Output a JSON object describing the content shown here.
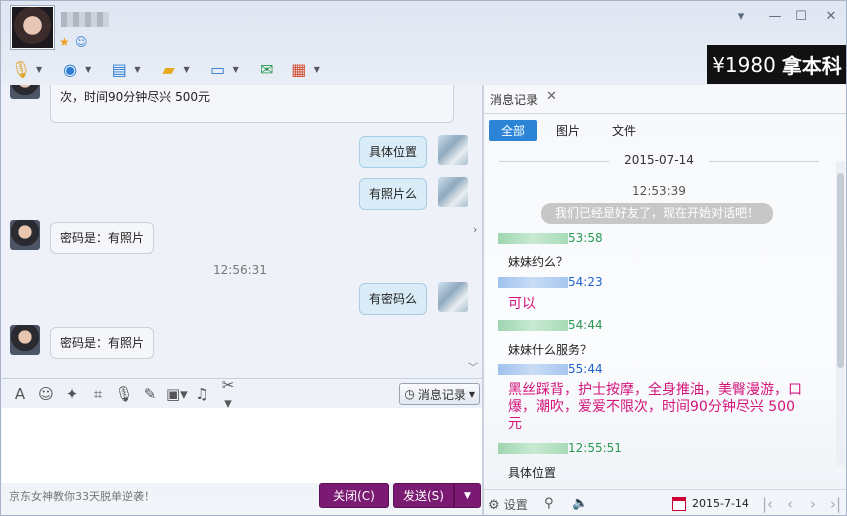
{
  "header": {
    "status_icons": [
      "star-icon",
      "qq-icon"
    ]
  },
  "ad": {
    "price": "¥1980",
    "text": "拿本科"
  },
  "chat": {
    "msg0_tail": "次，时间90分钟尽兴 500元",
    "msg1": "具体位置",
    "msg2": "有照片么",
    "msg3": "密码是：有照片",
    "ts1": "12:56:31",
    "msg4": "有密码么",
    "msg5": "密码是：有照片"
  },
  "input_toolbar": {
    "history_label": "消息记录"
  },
  "footer": {
    "ad_text": "京东女神教你33天脱单逆袭！",
    "close_label": "关闭(C)",
    "send_label": "发送(S)"
  },
  "history": {
    "tab_title": "消息记录",
    "filters": [
      "全部",
      "图片",
      "文件"
    ],
    "date": "2015-07-14",
    "ts": "12:53:39",
    "system_msg": "我们已经是好友了，现在开始对话吧！",
    "entries": [
      {
        "time": "53:58",
        "text": "妹妹约么？"
      },
      {
        "time": "54:23",
        "text": "可以"
      },
      {
        "time": "54:44",
        "text": "妹妹什么服务？"
      },
      {
        "time": "55:44",
        "text": "黑丝踩背，护士按摩，全身推油，美臀漫游，口爆，潮吹，爱爱不限次，时间90分钟尽兴 500元"
      },
      {
        "time": "12:55:51",
        "text": "具体位置"
      }
    ],
    "settings_label": "设置",
    "footer_date": "2015-7-14"
  }
}
